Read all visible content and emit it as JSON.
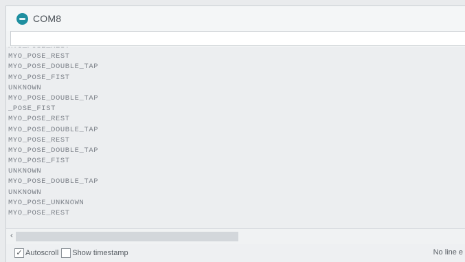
{
  "window": {
    "title": "COM8"
  },
  "monitor": {
    "lines": [
      "MYO_POSE_REST",
      "MYO_POSE_REST",
      "MYO_POSE_DOUBLE_TAP",
      "MYO_POSE_FIST",
      "UNKNOWN",
      "MYO_POSE_DOUBLE_TAP",
      "_POSE_FIST",
      "MYO_POSE_REST",
      "MYO_POSE_DOUBLE_TAP",
      "MYO_POSE_REST",
      "MYO_POSE_DOUBLE_TAP",
      "MYO_POSE_FIST",
      "UNKNOWN",
      "MYO_POSE_DOUBLE_TAP",
      "UNKNOWN",
      "MYO_POSE_UNKNOWN",
      "MYO_POSE_REST"
    ]
  },
  "statusbar": {
    "autoscroll_label": "Autoscroll",
    "autoscroll_checked": true,
    "timestamp_label": "Show timestamp",
    "timestamp_checked": false,
    "line_ending": "No line e"
  },
  "icons": {
    "app": "arduino-icon",
    "scroll_left": "scroll-left-arrow-icon",
    "check": "checkmark-icon"
  },
  "colors": {
    "app_icon": "#1e8fa0",
    "background": "#eceef0",
    "text": "#7b8088"
  }
}
